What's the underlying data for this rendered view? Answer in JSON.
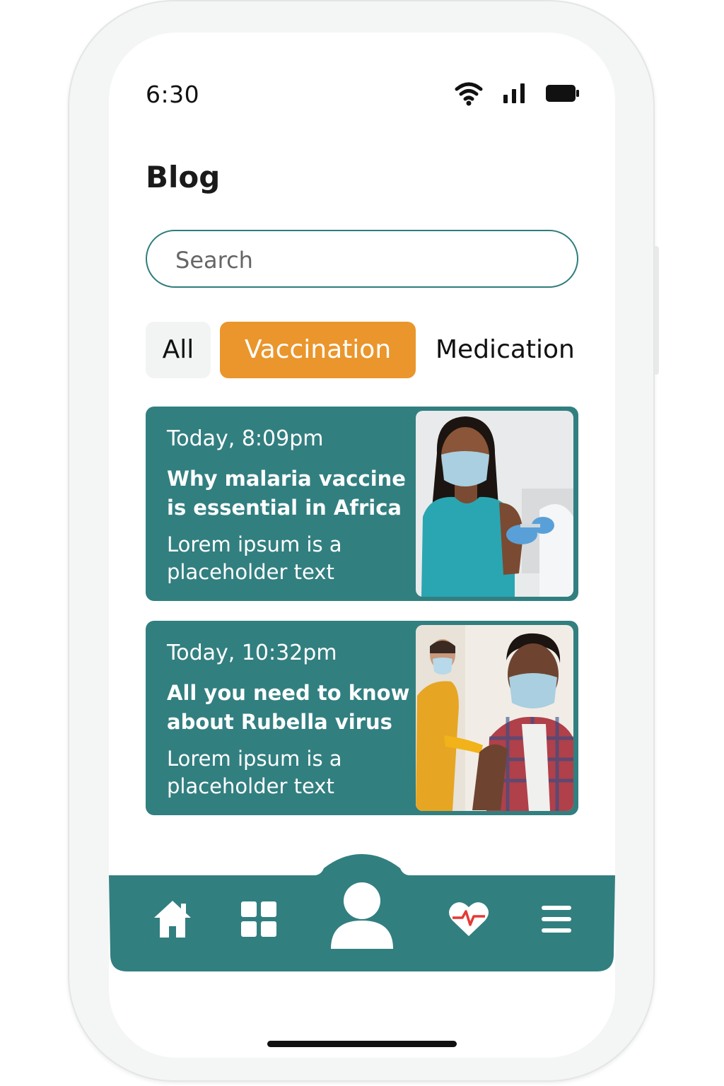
{
  "status_bar": {
    "time": "6:30",
    "icons": [
      "wifi-icon",
      "signal-icon",
      "battery-icon"
    ]
  },
  "header": {
    "title": "Blog"
  },
  "search": {
    "placeholder": "Search",
    "value": ""
  },
  "tabs": [
    {
      "label": "All",
      "selected": false
    },
    {
      "label": "Vaccination",
      "selected": true
    },
    {
      "label": "Medication",
      "selected": false
    }
  ],
  "posts": [
    {
      "date": "Today, 8:09pm",
      "title": "Why malaria vaccine is essential in Africa",
      "excerpt": "Lorem ipsum is a placeholder text",
      "image": "woman-receiving-vaccine-photo"
    },
    {
      "date": "Today, 10:32pm",
      "title": "All you need to know about Rubella virus",
      "excerpt": "Lorem ipsum is a placeholder text",
      "image": "man-receiving-vaccine-photo"
    }
  ],
  "bottom_nav": {
    "items": [
      "home-icon",
      "grid-icon",
      "profile-icon",
      "heart-pulse-icon",
      "menu-icon"
    ],
    "active": "profile-icon"
  },
  "colors": {
    "accent_teal": "#327f80",
    "accent_orange": "#ea962c",
    "heart_red": "#e53935"
  }
}
